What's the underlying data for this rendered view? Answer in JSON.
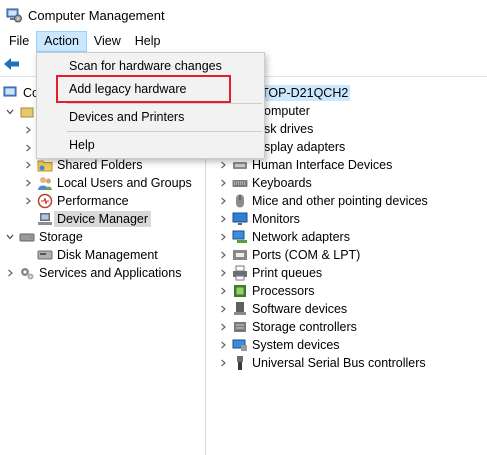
{
  "window": {
    "title": "Computer Management"
  },
  "menubar": {
    "items": [
      "File",
      "Action",
      "View",
      "Help"
    ]
  },
  "action_menu": {
    "items": [
      {
        "label": "Scan for hardware changes"
      },
      {
        "label": "Add legacy hardware",
        "highlighted": true
      },
      {
        "label": "Devices and Printers"
      },
      {
        "label": "Help"
      }
    ]
  },
  "left_tree": {
    "root_partial": "Co",
    "items": [
      {
        "label": "Shared Folders",
        "icon": "shared-folders-icon",
        "expander": "collapsed"
      },
      {
        "label": "Local Users and Groups",
        "icon": "users-icon",
        "expander": "collapsed"
      },
      {
        "label": "Performance",
        "icon": "performance-icon",
        "expander": "collapsed"
      },
      {
        "label": "Device Manager",
        "icon": "device-manager-icon",
        "expander": "none",
        "selected": true
      },
      {
        "label": "Storage",
        "icon": "storage-icon",
        "expander": "expanded"
      },
      {
        "label": "Disk Management",
        "icon": "disk-management-icon",
        "expander": "none"
      },
      {
        "label": "Services and Applications",
        "icon": "services-icon",
        "expander": "collapsed"
      }
    ]
  },
  "device_tree": {
    "root_partial": "TOP-D21QCH2",
    "partial_items": [
      "omputer",
      "sk drives",
      "splay adapters"
    ],
    "items": [
      {
        "label": "Human Interface Devices",
        "icon": "hid-icon"
      },
      {
        "label": "Keyboards",
        "icon": "keyboard-icon"
      },
      {
        "label": "Mice and other pointing devices",
        "icon": "mouse-icon"
      },
      {
        "label": "Monitors",
        "icon": "monitor-icon"
      },
      {
        "label": "Network adapters",
        "icon": "network-adapter-icon"
      },
      {
        "label": "Ports (COM & LPT)",
        "icon": "port-icon"
      },
      {
        "label": "Print queues",
        "icon": "printer-icon"
      },
      {
        "label": "Processors",
        "icon": "processor-icon"
      },
      {
        "label": "Software devices",
        "icon": "software-device-icon"
      },
      {
        "label": "Storage controllers",
        "icon": "storage-controller-icon"
      },
      {
        "label": "System devices",
        "icon": "system-device-icon"
      },
      {
        "label": "Universal Serial Bus controllers",
        "icon": "usb-icon"
      }
    ]
  },
  "colors": {
    "menu_active_bg": "#cce8ff",
    "highlight_box": "#e3202a",
    "dropdown_bg": "#f2f2f2",
    "selected_bg": "#d9d9d9"
  }
}
